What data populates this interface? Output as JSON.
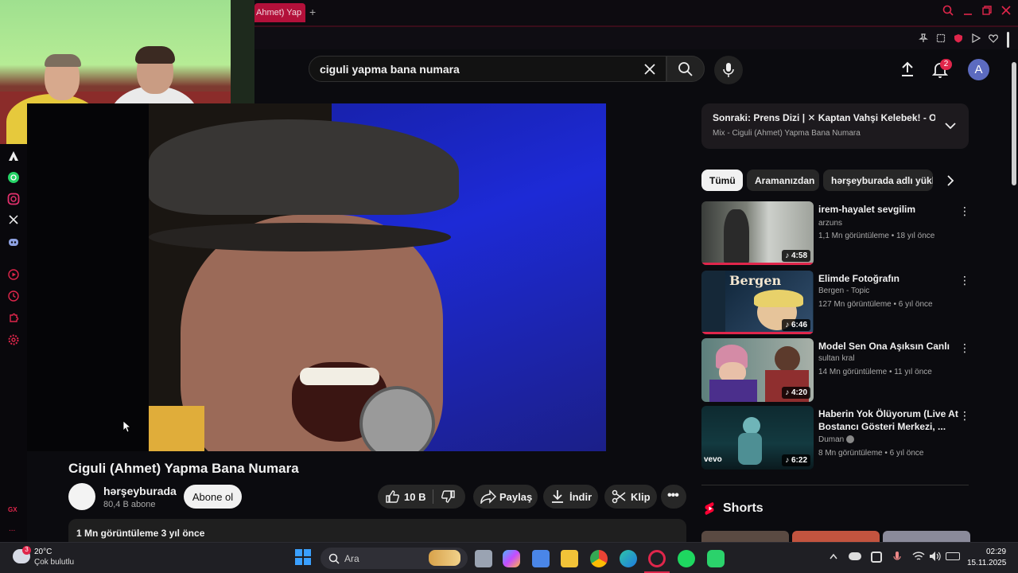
{
  "browser": {
    "tab_title": "Ahmet) Yap",
    "new_tab_symbol": "+"
  },
  "search": {
    "query": "ciguli yapma bana numara"
  },
  "header": {
    "notification_count": "2",
    "avatar_letter": "A"
  },
  "video": {
    "title": "Ciguli (Ahmet) Yapma Bana Numara",
    "channel_name": "hərşeyburada",
    "channel_subscribers": "80,4 B abone",
    "subscribe_label": "Abone ol",
    "like_count": "10 B",
    "share_label": "Paylaş",
    "download_label": "İndir",
    "clip_label": "Klip",
    "description_stats": "1 Mn görüntüleme  3 yıl önce"
  },
  "up_next": {
    "title": "Sonraki: Prens Dizi | ✕ Kaptan Vahşi Kelebek! - Off...",
    "subtitle": "Mix - Ciguli (Ahmet) Yapma Bana Numara"
  },
  "chips": [
    "Tümü",
    "Aramanızdan",
    "hərşeyburada adlı yükleyici"
  ],
  "recommendations": [
    {
      "title": "irem-hayalet sevgilim",
      "channel": "arzuns",
      "meta": "1,1 Mn görüntüleme • 18 yıl önce",
      "duration": "4:58"
    },
    {
      "title": "Elimde Fotoğrafın",
      "channel": "Bergen - Topic",
      "meta": "127 Mn görüntüleme • 6 yıl önce",
      "duration": "6:46"
    },
    {
      "title": "Model  Sen Ona Aşıksın Canlı",
      "channel": "sultan kral",
      "meta": "14 Mn görüntüleme • 11 yıl önce",
      "duration": "4:20"
    },
    {
      "title": "Haberin Yok Ölüyorum (Live At Bostancı Gösteri Merkezi, ...",
      "channel": "Duman",
      "meta": "8 Mn görüntüleme • 6 yıl önce",
      "duration": "6:22"
    }
  ],
  "thumb_texts": {
    "bergen_logo": "Bergen",
    "vevo": "vevo"
  },
  "shorts": {
    "label": "Shorts"
  },
  "sidebar": {
    "gx_label": "GX",
    "more_label": "..."
  },
  "taskbar": {
    "weather_temp": "20°C",
    "weather_desc": "Çok bulutlu",
    "weather_badge": "3",
    "search_placeholder": "Ara",
    "time": "02:29",
    "date": "15.11.2025"
  },
  "colors": {
    "accent": "#e0264b",
    "chip_active_bg": "#f1f1f1",
    "shorts_red": "#ff0033"
  }
}
